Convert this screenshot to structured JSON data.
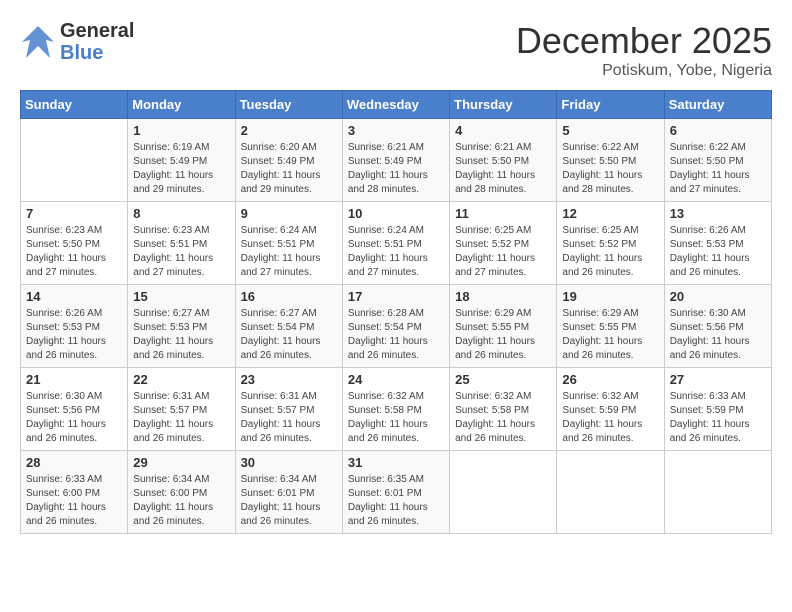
{
  "logo": {
    "line1": "General",
    "line2": "Blue"
  },
  "title": "December 2025",
  "subtitle": "Potiskum, Yobe, Nigeria",
  "weekdays": [
    "Sunday",
    "Monday",
    "Tuesday",
    "Wednesday",
    "Thursday",
    "Friday",
    "Saturday"
  ],
  "weeks": [
    [
      {
        "day": "",
        "info": ""
      },
      {
        "day": "1",
        "info": "Sunrise: 6:19 AM\nSunset: 5:49 PM\nDaylight: 11 hours\nand 29 minutes."
      },
      {
        "day": "2",
        "info": "Sunrise: 6:20 AM\nSunset: 5:49 PM\nDaylight: 11 hours\nand 29 minutes."
      },
      {
        "day": "3",
        "info": "Sunrise: 6:21 AM\nSunset: 5:49 PM\nDaylight: 11 hours\nand 28 minutes."
      },
      {
        "day": "4",
        "info": "Sunrise: 6:21 AM\nSunset: 5:50 PM\nDaylight: 11 hours\nand 28 minutes."
      },
      {
        "day": "5",
        "info": "Sunrise: 6:22 AM\nSunset: 5:50 PM\nDaylight: 11 hours\nand 28 minutes."
      },
      {
        "day": "6",
        "info": "Sunrise: 6:22 AM\nSunset: 5:50 PM\nDaylight: 11 hours\nand 27 minutes."
      }
    ],
    [
      {
        "day": "7",
        "info": "Sunrise: 6:23 AM\nSunset: 5:50 PM\nDaylight: 11 hours\nand 27 minutes."
      },
      {
        "day": "8",
        "info": "Sunrise: 6:23 AM\nSunset: 5:51 PM\nDaylight: 11 hours\nand 27 minutes."
      },
      {
        "day": "9",
        "info": "Sunrise: 6:24 AM\nSunset: 5:51 PM\nDaylight: 11 hours\nand 27 minutes."
      },
      {
        "day": "10",
        "info": "Sunrise: 6:24 AM\nSunset: 5:51 PM\nDaylight: 11 hours\nand 27 minutes."
      },
      {
        "day": "11",
        "info": "Sunrise: 6:25 AM\nSunset: 5:52 PM\nDaylight: 11 hours\nand 27 minutes."
      },
      {
        "day": "12",
        "info": "Sunrise: 6:25 AM\nSunset: 5:52 PM\nDaylight: 11 hours\nand 26 minutes."
      },
      {
        "day": "13",
        "info": "Sunrise: 6:26 AM\nSunset: 5:53 PM\nDaylight: 11 hours\nand 26 minutes."
      }
    ],
    [
      {
        "day": "14",
        "info": "Sunrise: 6:26 AM\nSunset: 5:53 PM\nDaylight: 11 hours\nand 26 minutes."
      },
      {
        "day": "15",
        "info": "Sunrise: 6:27 AM\nSunset: 5:53 PM\nDaylight: 11 hours\nand 26 minutes."
      },
      {
        "day": "16",
        "info": "Sunrise: 6:27 AM\nSunset: 5:54 PM\nDaylight: 11 hours\nand 26 minutes."
      },
      {
        "day": "17",
        "info": "Sunrise: 6:28 AM\nSunset: 5:54 PM\nDaylight: 11 hours\nand 26 minutes."
      },
      {
        "day": "18",
        "info": "Sunrise: 6:29 AM\nSunset: 5:55 PM\nDaylight: 11 hours\nand 26 minutes."
      },
      {
        "day": "19",
        "info": "Sunrise: 6:29 AM\nSunset: 5:55 PM\nDaylight: 11 hours\nand 26 minutes."
      },
      {
        "day": "20",
        "info": "Sunrise: 6:30 AM\nSunset: 5:56 PM\nDaylight: 11 hours\nand 26 minutes."
      }
    ],
    [
      {
        "day": "21",
        "info": "Sunrise: 6:30 AM\nSunset: 5:56 PM\nDaylight: 11 hours\nand 26 minutes."
      },
      {
        "day": "22",
        "info": "Sunrise: 6:31 AM\nSunset: 5:57 PM\nDaylight: 11 hours\nand 26 minutes."
      },
      {
        "day": "23",
        "info": "Sunrise: 6:31 AM\nSunset: 5:57 PM\nDaylight: 11 hours\nand 26 minutes."
      },
      {
        "day": "24",
        "info": "Sunrise: 6:32 AM\nSunset: 5:58 PM\nDaylight: 11 hours\nand 26 minutes."
      },
      {
        "day": "25",
        "info": "Sunrise: 6:32 AM\nSunset: 5:58 PM\nDaylight: 11 hours\nand 26 minutes."
      },
      {
        "day": "26",
        "info": "Sunrise: 6:32 AM\nSunset: 5:59 PM\nDaylight: 11 hours\nand 26 minutes."
      },
      {
        "day": "27",
        "info": "Sunrise: 6:33 AM\nSunset: 5:59 PM\nDaylight: 11 hours\nand 26 minutes."
      }
    ],
    [
      {
        "day": "28",
        "info": "Sunrise: 6:33 AM\nSunset: 6:00 PM\nDaylight: 11 hours\nand 26 minutes."
      },
      {
        "day": "29",
        "info": "Sunrise: 6:34 AM\nSunset: 6:00 PM\nDaylight: 11 hours\nand 26 minutes."
      },
      {
        "day": "30",
        "info": "Sunrise: 6:34 AM\nSunset: 6:01 PM\nDaylight: 11 hours\nand 26 minutes."
      },
      {
        "day": "31",
        "info": "Sunrise: 6:35 AM\nSunset: 6:01 PM\nDaylight: 11 hours\nand 26 minutes."
      },
      {
        "day": "",
        "info": ""
      },
      {
        "day": "",
        "info": ""
      },
      {
        "day": "",
        "info": ""
      }
    ]
  ]
}
